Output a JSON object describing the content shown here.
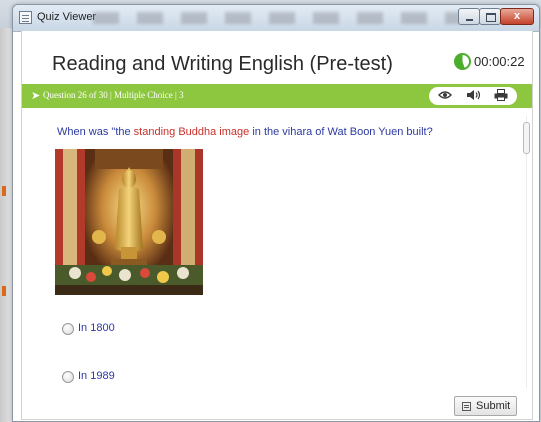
{
  "window": {
    "title": "Quiz Viewer",
    "close_glyph": "x"
  },
  "quiz": {
    "title": "Reading and Writing English (Pre-test)",
    "timer": "00:00:22"
  },
  "question_bar": {
    "info": "Question 26 of 30 | Multiple Choice | 3",
    "tools": [
      "eye-icon",
      "speaker-icon",
      "print-icon"
    ]
  },
  "question": {
    "text_before": "When was \"the ",
    "highlight": "standing Buddha image",
    "text_after": " in the vihara of Wat Boon Yuen built?"
  },
  "options": [
    {
      "label": "In 1800",
      "selected": false
    },
    {
      "label": "In 1989",
      "selected": false
    }
  ],
  "submit": {
    "label": "Submit"
  },
  "colors": {
    "bar_green": "#8dc63f",
    "question_blue": "#2b3aa0",
    "highlight_red": "#c8312b"
  }
}
